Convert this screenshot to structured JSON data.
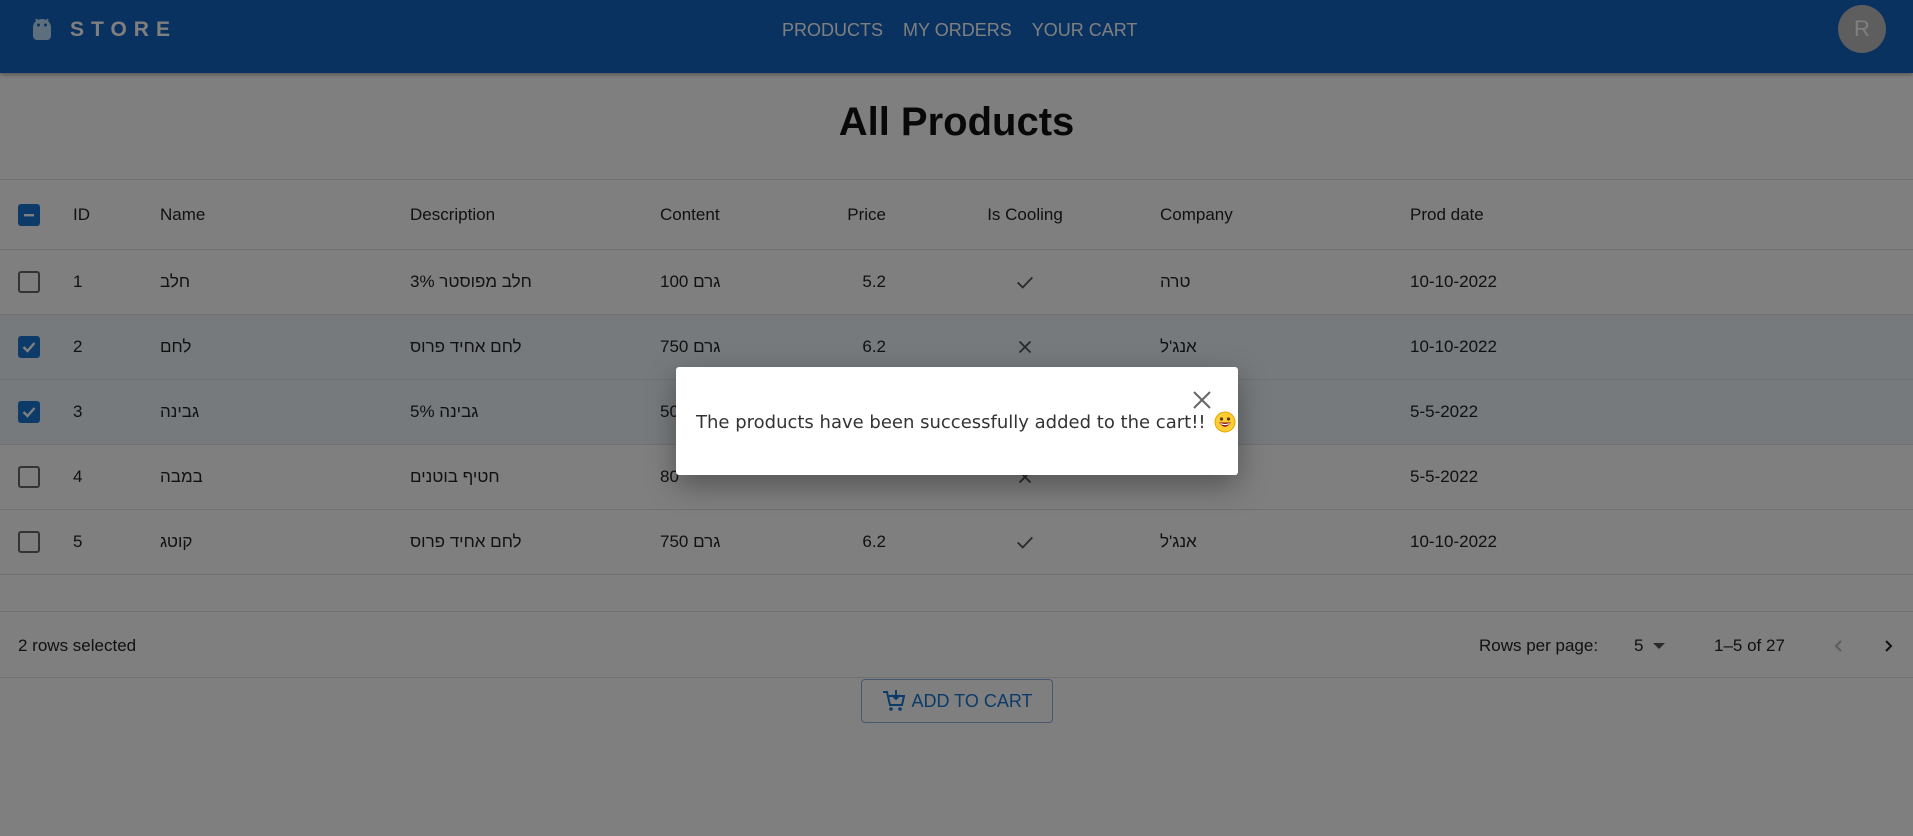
{
  "header": {
    "brand": "STORE",
    "nav": [
      "PRODUCTS",
      "MY ORDERS",
      "YOUR CART"
    ],
    "avatar_initial": "R",
    "background": "#1565c0"
  },
  "page": {
    "title": "All Products"
  },
  "table": {
    "columns": [
      "ID",
      "Name",
      "Description",
      "Content",
      "Price",
      "Is Cooling",
      "Company",
      "Prod date"
    ],
    "rows": [
      {
        "id": "1",
        "name": "חלב",
        "description": "3% חלב מפוסטר",
        "content": "100 גרם",
        "price": "5.2",
        "cooling": "check-icon",
        "company": "טרה",
        "date": "10-10-2022",
        "selected": false
      },
      {
        "id": "2",
        "name": "לחם",
        "description": "לחם אחיד פרוס",
        "content": "750 גרם",
        "price": "6.2",
        "cooling": "x-icon",
        "company": "אנג'ל",
        "date": "10-10-2022",
        "selected": true
      },
      {
        "id": "3",
        "name": "גבינה",
        "description": "5% גבינה",
        "content": "50",
        "price": "",
        "cooling": "",
        "company": "",
        "date": "5-5-2022",
        "selected": true
      },
      {
        "id": "4",
        "name": "במבה",
        "description": "חטיף בוטנים",
        "content": "80",
        "price": "",
        "cooling": "x-icon",
        "company": "",
        "date": "5-5-2022",
        "selected": false
      },
      {
        "id": "5",
        "name": "קוטג",
        "description": "לחם אחיד פרוס",
        "content": "750 גרם",
        "price": "6.2",
        "cooling": "check-icon",
        "company": "אנג'ל",
        "date": "10-10-2022",
        "selected": false
      }
    ]
  },
  "footer": {
    "selected_text": "2 rows selected",
    "rows_per_page_label": "Rows per page:",
    "rows_per_page": "5",
    "range": "1–5 of 27"
  },
  "actions": {
    "add_to_cart": "ADD TO CART"
  },
  "dialog": {
    "message": "The products have been successfully added to the cart!!",
    "emoji": "grinning-face-icon"
  },
  "colors": {
    "primary": "#1976d2",
    "overlay": "rgba(0,0,0,0.5)"
  }
}
